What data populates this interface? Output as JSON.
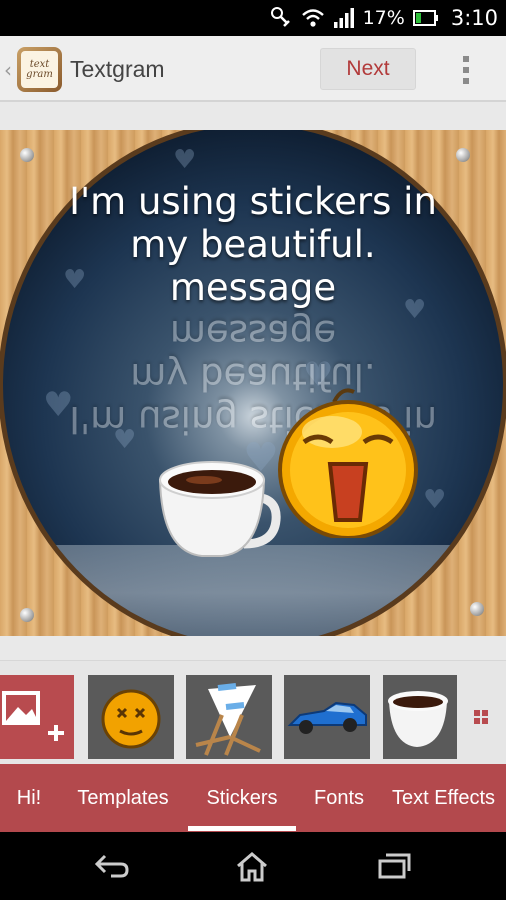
{
  "status_bar": {
    "battery_percent": "17%",
    "time": "3:10"
  },
  "action_bar": {
    "app_icon_lines": [
      "text",
      "gram"
    ],
    "title": "Textgram",
    "next_label": "Next"
  },
  "canvas": {
    "message_lines": [
      "I'm using stickers in",
      "my beautiful.",
      "message"
    ],
    "stickers_on_canvas": [
      "coffee-cup",
      "yawning-smiley"
    ]
  },
  "sticker_strip": {
    "items": [
      "add-image",
      "dizzy-smiley",
      "beach-chair",
      "blue-car",
      "coffee-cup"
    ]
  },
  "tabs": {
    "items": [
      "Hi!",
      "Templates",
      "Stickers",
      "Fonts",
      "Text Effects"
    ],
    "selected": "Stickers"
  },
  "colors": {
    "accent": "#b3494d",
    "next_text": "#b23a3a"
  }
}
